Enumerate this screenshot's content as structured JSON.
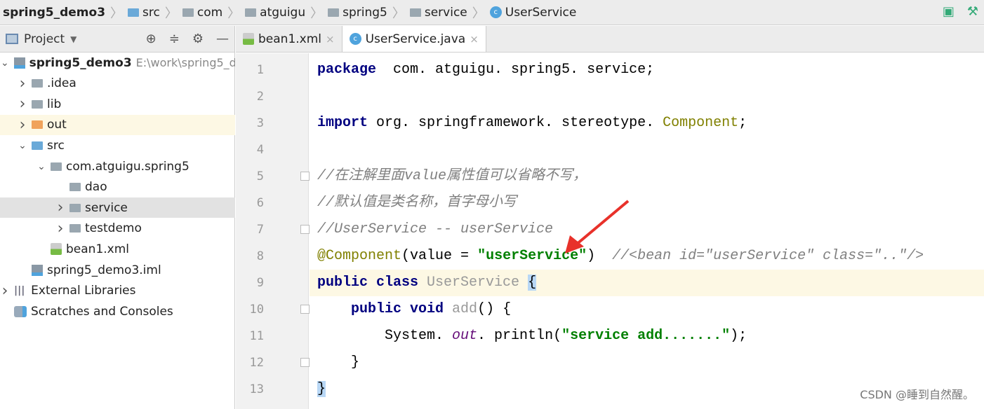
{
  "breadcrumb": [
    {
      "label": "spring5_demo3",
      "icon": "none"
    },
    {
      "label": "src",
      "icon": "folder-blue"
    },
    {
      "label": "com",
      "icon": "folder"
    },
    {
      "label": "atguigu",
      "icon": "folder"
    },
    {
      "label": "spring5",
      "icon": "folder"
    },
    {
      "label": "service",
      "icon": "folder"
    },
    {
      "label": "UserService",
      "icon": "class"
    }
  ],
  "sidebar": {
    "title": "Project",
    "tree": [
      {
        "label": "spring5_demo3",
        "path": "E:\\work\\spring5_d",
        "arrow": "down",
        "indent": 0,
        "icon": "module",
        "bold": true
      },
      {
        "label": ".idea",
        "arrow": "right",
        "indent": 1,
        "icon": "folder"
      },
      {
        "label": "lib",
        "arrow": "right",
        "indent": 1,
        "icon": "folder"
      },
      {
        "label": "out",
        "arrow": "right",
        "indent": 1,
        "icon": "folder-orange",
        "state": "hl"
      },
      {
        "label": "src",
        "arrow": "down",
        "indent": 1,
        "icon": "folder-blue"
      },
      {
        "label": "com.atguigu.spring5",
        "arrow": "down",
        "indent": 2,
        "icon": "package"
      },
      {
        "label": "dao",
        "arrow": "",
        "indent": 3,
        "icon": "package"
      },
      {
        "label": "service",
        "arrow": "right",
        "indent": 3,
        "icon": "package",
        "state": "sel"
      },
      {
        "label": "testdemo",
        "arrow": "right",
        "indent": 3,
        "icon": "package"
      },
      {
        "label": "bean1.xml",
        "arrow": "",
        "indent": 2,
        "icon": "xml"
      },
      {
        "label": "spring5_demo3.iml",
        "arrow": "",
        "indent": 1,
        "icon": "iml"
      },
      {
        "label": "External Libraries",
        "arrow": "right",
        "indent": 0,
        "icon": "libraries"
      },
      {
        "label": "Scratches and Consoles",
        "arrow": "",
        "indent": 0,
        "icon": "scratches"
      }
    ]
  },
  "tabs": [
    {
      "label": "bean1.xml",
      "icon": "xml",
      "active": false
    },
    {
      "label": "UserService.java",
      "icon": "class",
      "active": true
    }
  ],
  "code": [
    [
      [
        "kw",
        "package"
      ],
      [
        "",
        "  com. atguigu. spring5. service;"
      ]
    ],
    [],
    [
      [
        "kw",
        "import"
      ],
      [
        "",
        " org. springframework. stereotype. "
      ],
      [
        "an",
        "Component"
      ],
      [
        "",
        ";"
      ]
    ],
    [],
    [
      [
        "cm",
        "//在注解里面value属性值可以省略不写，"
      ]
    ],
    [
      [
        "cm",
        "//默认值是类名称，首字母小写"
      ]
    ],
    [
      [
        "cm",
        "//UserService -- userService"
      ]
    ],
    [
      [
        "an",
        "@Component"
      ],
      [
        "",
        "(value = "
      ],
      [
        "str",
        "\"userService\""
      ],
      [
        "",
        ")  "
      ],
      [
        "cm",
        "//<bean id=\"userService\" class=\"..\"/>"
      ]
    ],
    [
      [
        "kw",
        "public class "
      ],
      [
        "gr",
        "UserService "
      ],
      [
        "br",
        "{"
      ]
    ],
    [
      [
        "",
        "    "
      ],
      [
        "kw",
        "public void "
      ],
      [
        "gr",
        "add"
      ],
      [
        "",
        "() {"
      ]
    ],
    [
      [
        "",
        "        System. "
      ],
      [
        "fld",
        "out"
      ],
      [
        "",
        ". println("
      ],
      [
        "str",
        "\"service add.......\""
      ],
      [
        "",
        ");"
      ]
    ],
    [
      [
        "",
        "    }"
      ]
    ],
    [
      [
        "br",
        "}"
      ]
    ]
  ],
  "current_line": 9,
  "watermark": "CSDN @睡到自然醒。",
  "colors": {
    "arrow": "#e8312a",
    "keyword": "#000080",
    "string": "#008000",
    "comment": "#808080"
  }
}
